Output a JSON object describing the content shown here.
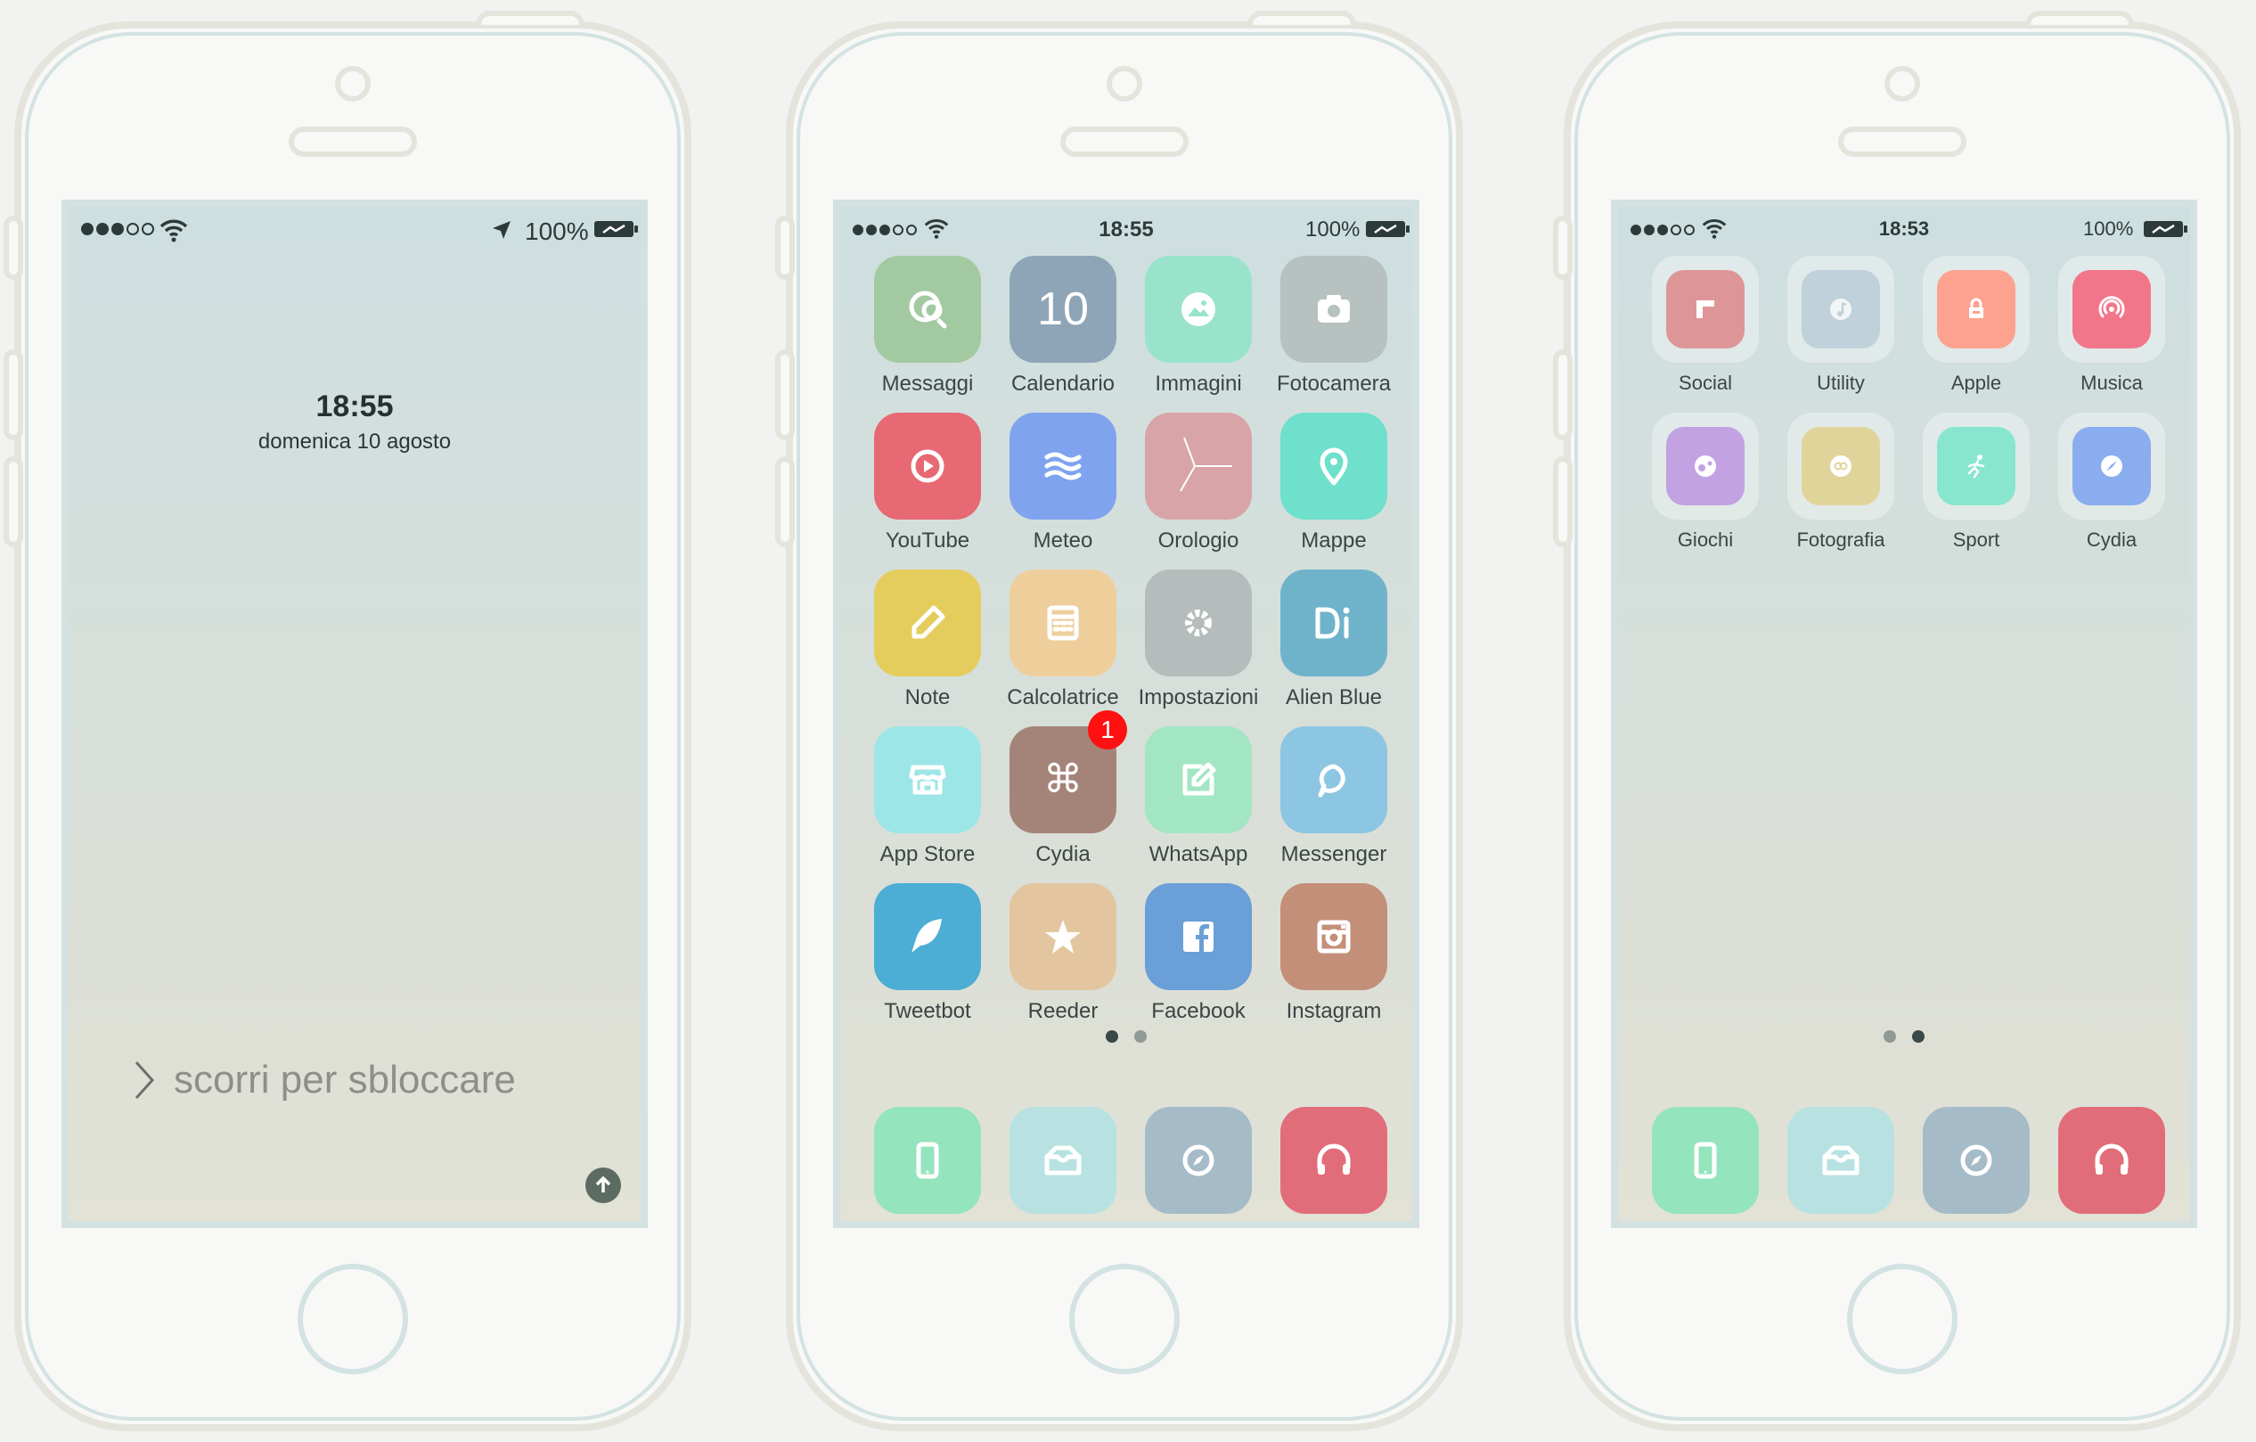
{
  "colors": {
    "frame": "#e4e4dc",
    "accent": "#d4e1e1",
    "text": "#3b4545",
    "badge": "#ff1111"
  },
  "lock": {
    "status": {
      "battery": "100%",
      "icons": [
        "signal-dots",
        "wifi-icon",
        "location-arrow-icon",
        "battery-charging-icon"
      ]
    },
    "time": "18:55",
    "date": "domenica 10 agosto",
    "slide": "scorri per sbloccare"
  },
  "home1": {
    "status": {
      "time": "18:55",
      "battery": "100%"
    },
    "apps": [
      {
        "label": "Messaggi",
        "color": "#a3c9a1",
        "icon": "messages-icon"
      },
      {
        "label": "Calendario",
        "color": "#8ea5b7",
        "icon": "calendar-icon",
        "text": "10"
      },
      {
        "label": "Immagini",
        "color": "#99e3cb",
        "icon": "photos-icon"
      },
      {
        "label": "Fotocamera",
        "color": "#b6c1c0",
        "icon": "camera-icon"
      },
      {
        "label": "YouTube",
        "color": "#e76973",
        "icon": "youtube-icon"
      },
      {
        "label": "Meteo",
        "color": "#80a3ef",
        "icon": "weather-icon"
      },
      {
        "label": "Orologio",
        "color": "#d8a4a7",
        "icon": "clock-icon"
      },
      {
        "label": "Mappe",
        "color": "#6ee0cb",
        "icon": "map-pin-icon"
      },
      {
        "label": "Note",
        "color": "#e4cd5d",
        "icon": "pencil-icon"
      },
      {
        "label": "Calcolatrice",
        "color": "#eecf9c",
        "icon": "calculator-icon"
      },
      {
        "label": "Impostazioni",
        "color": "#b4bdbc",
        "icon": "gear-icon"
      },
      {
        "label": "Alien Blue",
        "color": "#6fb3cb",
        "icon": "alien-blue-icon"
      },
      {
        "label": "App Store",
        "color": "#9de6e7",
        "icon": "store-icon"
      },
      {
        "label": "Cydia",
        "color": "#a48479",
        "icon": "command-icon",
        "badge": "1"
      },
      {
        "label": "WhatsApp",
        "color": "#a2e6c4",
        "icon": "compose-icon"
      },
      {
        "label": "Messenger",
        "color": "#8cc6e2",
        "icon": "chat-bubble-icon"
      },
      {
        "label": "Tweetbot",
        "color": "#4cadd5",
        "icon": "bird-icon"
      },
      {
        "label": "Reeder",
        "color": "#e3c69f",
        "icon": "star-icon"
      },
      {
        "label": "Facebook",
        "color": "#6a9fd7",
        "icon": "facebook-icon"
      },
      {
        "label": "Instagram",
        "color": "#c48f79",
        "icon": "instagram-icon"
      }
    ],
    "dock": [
      {
        "label": "Telefono",
        "color": "#94e4be",
        "icon": "phone-icon"
      },
      {
        "label": "Mail",
        "color": "#b7e2e1",
        "icon": "mail-icon"
      },
      {
        "label": "Safari",
        "color": "#a6bbc8",
        "icon": "safari-icon"
      },
      {
        "label": "Musica",
        "color": "#e26d7a",
        "icon": "headphones-icon"
      }
    ]
  },
  "home2": {
    "status": {
      "time": "18:53",
      "battery": "100%"
    },
    "folders": [
      {
        "label": "Social",
        "color": "#de9597",
        "icon": "flipboard-icon"
      },
      {
        "label": "Utility",
        "color": "#c0d1db",
        "icon": "music-note-icon"
      },
      {
        "label": "Apple",
        "color": "#fca28f",
        "icon": "bag-icon"
      },
      {
        "label": "Musica",
        "color": "#f27689",
        "icon": "radio-icon"
      },
      {
        "label": "Giochi",
        "color": "#c2a2e2",
        "icon": "game-icon"
      },
      {
        "label": "Fotografia",
        "color": "#e1d49a",
        "icon": "photo-folder-icon"
      },
      {
        "label": "Sport",
        "color": "#88e6cf",
        "icon": "runner-icon"
      },
      {
        "label": "Cydia",
        "color": "#8aadef",
        "icon": "compass-icon"
      }
    ],
    "dock": [
      {
        "label": "Telefono",
        "color": "#94e4be",
        "icon": "phone-icon"
      },
      {
        "label": "Mail",
        "color": "#b7e2e1",
        "icon": "mail-icon"
      },
      {
        "label": "Safari",
        "color": "#a6bbc8",
        "icon": "safari-icon"
      },
      {
        "label": "Musica",
        "color": "#e26d7a",
        "icon": "headphones-icon"
      }
    ]
  }
}
